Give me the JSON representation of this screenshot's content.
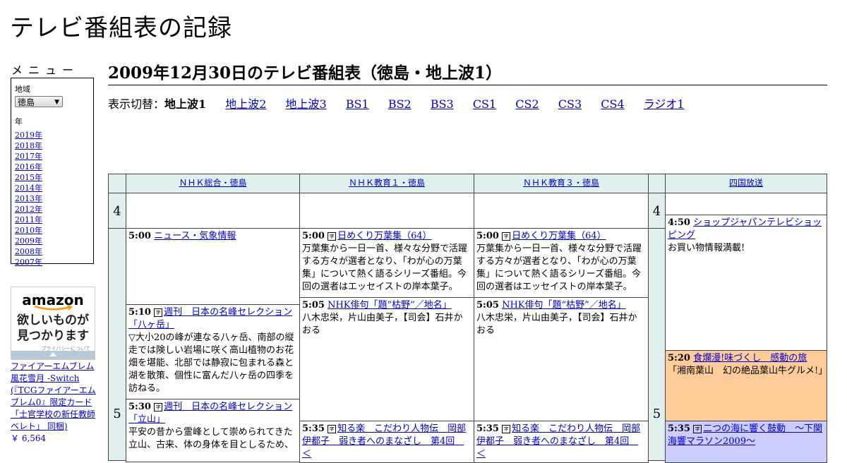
{
  "site": {
    "title": "テレビ番組表の記録"
  },
  "menu": {
    "heading": "メニュー",
    "region_label": "地域",
    "region_value": "徳島",
    "year_label": "年",
    "years": [
      "2019年",
      "2018年",
      "2017年",
      "2016年",
      "2015年",
      "2014年",
      "2013年",
      "2012年",
      "2011年",
      "2010年",
      "2009年",
      "2008年",
      "2007年"
    ]
  },
  "ad": {
    "logo": "amazon",
    "text_line1": "欲しいものが",
    "text_line2": "見つかります",
    "privacy": "プライバシーについて",
    "product": "ファイアーエムブレム 風花雪月 -Switch (『TCGファイアーエムブレム0』限定カード「士官学校の新任教師ベレト」 同梱)",
    "price": "￥ 6,564"
  },
  "main": {
    "heading": "2009年12月30日のテレビ番組表（徳島・地上波1）",
    "switch_label": "表示切替：",
    "current": "地上波1",
    "links": [
      "地上波2",
      "地上波3",
      "BS1",
      "BS2",
      "BS3",
      "CS1",
      "CS2",
      "CS3",
      "CS4",
      "ラジオ1"
    ]
  },
  "grid": {
    "channels": [
      "ＮＨＫ総合・徳島",
      "ＮＨＫ教育１・徳島",
      "ＮＨＫ教育３・徳島",
      "四国放送"
    ],
    "hours": [
      "4",
      "5"
    ],
    "programs": {
      "g1": {
        "time": "5:00",
        "title": "ニュース・気象情報",
        "desc": ""
      },
      "g2": {
        "time": "5:10",
        "title": "週刊　日本の名峰セレクション「八ヶ岳」",
        "desc": "▽大小20の峰が連なる八ヶ岳、南部の縦走では険しい岩場に咲く高山植物のお花畑を堪能、北部では静寂に包まれる森と湖を散策、個性に富んだ八ヶ岳の四季を訪ねる。"
      },
      "g3": {
        "time": "5:30",
        "title": "週刊　日本の名峰セレクション「立山」",
        "desc": "平安の昔から霊峰として崇められてきた立山、古来、体の身体を目としるため、"
      },
      "e1a": {
        "time": "5:00",
        "title": "日めくり万葉集（64）",
        "desc": "万葉集から一日一首、様々な分野で活躍する方々が選者となり、「わが心の万葉集」について熱く語るシリーズ番組。今回の選者はエッセイストの岸本葉子。"
      },
      "e1b": {
        "time": "5:05",
        "title": "NHK俳句「題“枯野”／地名」",
        "desc": "八木忠栄，片山由美子，【司会】石井かおる"
      },
      "e1c": {
        "time": "5:35",
        "title": "知る楽　こだわり人物伝　岡部伊都子　弱き者へのまなざし　第4回　＜",
        "desc": ""
      },
      "e3a": {
        "time": "5:00",
        "title": "日めくり万葉集（64）",
        "desc": "万葉集から一日一首、様々な分野で活躍する方々が選者となり、「わが心の万葉集」について熱く語るシリーズ番組。今回の選者はエッセイストの岸本葉子。"
      },
      "e3b": {
        "time": "5:05",
        "title": "NHK俳句「題“枯野”／地名」",
        "desc": "八木忠栄，片山由美子，【司会】石井かおる"
      },
      "e3c": {
        "time": "5:35",
        "title": "知る楽　こだわり人物伝　岡部伊都子　弱き者へのまなざし　第4回　＜",
        "desc": ""
      },
      "s1": {
        "time": "4:50",
        "title": "ショップジャパンテレビショッピング",
        "desc": "お買い物情報満載!"
      },
      "s2": {
        "time": "5:20",
        "title": "食爛漫!味づくし　感動の旅",
        "desc": "「湘南葉山　幻の絶品葉山牛グルメ!」"
      },
      "s3": {
        "time": "5:35",
        "title": "二つの海に響く鼓動　～下関海響マラソン2009～",
        "desc": ""
      }
    }
  },
  "colors": {
    "header_bg": "#dff0ee",
    "orange": "#ffcc99",
    "lavender": "#ccccff",
    "link": "#0000cc"
  }
}
